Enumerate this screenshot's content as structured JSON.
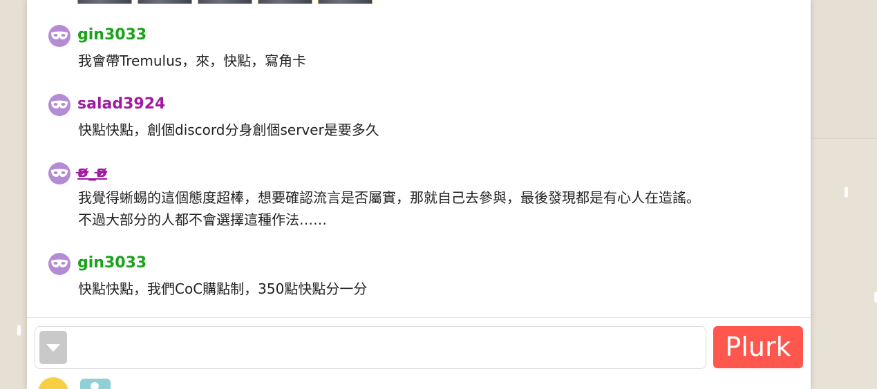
{
  "responses": [
    {
      "user": "gin3033",
      "text": "我會帶Tremulus，來，快點，寫角卡"
    },
    {
      "user": "salad3924",
      "text": "快點快點，創個discord分身創個server是要多久"
    },
    {
      "user": "ʚ̴̶̷̷_ʚ̴̶̷̷",
      "text_line1": "我覺得蜥蜴的這個態度超棒，想要確認流言是否屬實，那就自己去參與，最後發現都是有心人在造謠。",
      "text_line2": "不過大部分的人都不會選擇這種作法……"
    },
    {
      "user": "gin3033",
      "text": "快點快點，我們CoC購點制，350點快點分一分"
    }
  ],
  "composer": {
    "placeholder": "",
    "submit_label": "Plurk"
  },
  "icons": {
    "avatar": "anonymous-mask-icon",
    "qualifier": "chevron-down-icon",
    "emoticon": "emoticon-icon",
    "image_upload": "image-upload-icon"
  },
  "colors": {
    "user_green": "#1aa21a",
    "user_purple": "#a21aa2",
    "submit_button": "#ff574d",
    "avatar_bg": "#b48cd6"
  }
}
